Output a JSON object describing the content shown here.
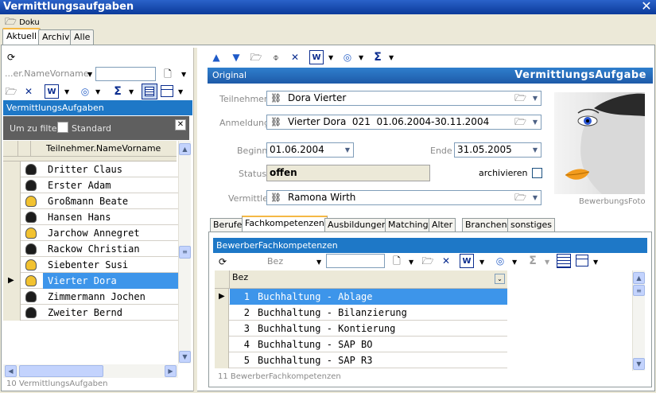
{
  "window": {
    "title": "Vermittlungsaufgaben",
    "close_glyph": "✕",
    "toolbar_label": "Doku"
  },
  "tabs": [
    {
      "label": "Aktuell"
    },
    {
      "label": "Archiv"
    },
    {
      "label": "Alle"
    }
  ],
  "left": {
    "search_field_label": "...er.NameVorname",
    "panel_title": "VermittlungsAufgaben",
    "filter_label": "Um zu filter",
    "filter_standard": "Standard",
    "column_header": "Teilnehmer.NameVorname",
    "rows": [
      {
        "name": "Dritter Claus",
        "icon": "male-person-icon"
      },
      {
        "name": "Erster Adam",
        "icon": "male-person-icon"
      },
      {
        "name": "Großmann Beate",
        "icon": "female-person-icon"
      },
      {
        "name": "Hansen Hans",
        "icon": "male-person-icon"
      },
      {
        "name": "Jarchow Annegret",
        "icon": "female-person-icon"
      },
      {
        "name": "Rackow Christian",
        "icon": "male-person-icon"
      },
      {
        "name": "Siebenter Susi",
        "icon": "female-person-icon"
      },
      {
        "name": "Vierter Dora",
        "icon": "female-person-icon",
        "selected": true
      },
      {
        "name": "Zimmermann Jochen",
        "icon": "male-person-icon"
      },
      {
        "name": "Zweiter Bernd",
        "icon": "male-person-icon"
      }
    ],
    "footer": "10 VermittlungsAufgaben"
  },
  "detail": {
    "header_left": "Original",
    "header_right": "VermittlungsAufgabe",
    "fields": {
      "teilnehmer_label": "Teilnehmer",
      "teilnehmer_value": "Dora Vierter",
      "anmeldung_label": "Anmeldung",
      "anmeldung_value": "Vierter Dora  021  01.06.2004-30.11.2004",
      "beginn_label": "Beginn",
      "beginn_value": "01.06.2004",
      "ende_label": "Ende",
      "ende_value": "31.05.2005",
      "status_label": "Status",
      "status_value": "offen",
      "archivieren_label": "archivieren",
      "vermittler_label": "Vermittler",
      "vermittler_value": "Ramona Wirth"
    },
    "photo_caption": "BewerbungsFoto"
  },
  "subtabs": [
    {
      "label": "Berufe"
    },
    {
      "label": "Fachkompetenzen"
    },
    {
      "label": "Ausbildungen"
    },
    {
      "label": "Matching"
    },
    {
      "label": "Alter"
    },
    {
      "label": "Branchen"
    },
    {
      "label": "sonstiges"
    }
  ],
  "kompetenzen": {
    "panel_title": "BewerberFachkompetenzen",
    "search_label": "Bez",
    "column_header": "Bez",
    "rows": [
      {
        "num": "1",
        "text": "Buchhaltung - Ablage",
        "selected": true
      },
      {
        "num": "2",
        "text": "Buchhaltung - Bilanzierung"
      },
      {
        "num": "3",
        "text": "Buchhaltung - Kontierung"
      },
      {
        "num": "4",
        "text": "Buchhaltung - SAP BO"
      },
      {
        "num": "5",
        "text": "Buchhaltung - SAP R3"
      }
    ],
    "footer": "11 BewerberFachkompetenzen"
  },
  "colors": {
    "titlebar": "#1c4fa8",
    "accent": "#1e78c7",
    "selection": "#3d95ea",
    "tab_highlight": "#f5b845"
  }
}
